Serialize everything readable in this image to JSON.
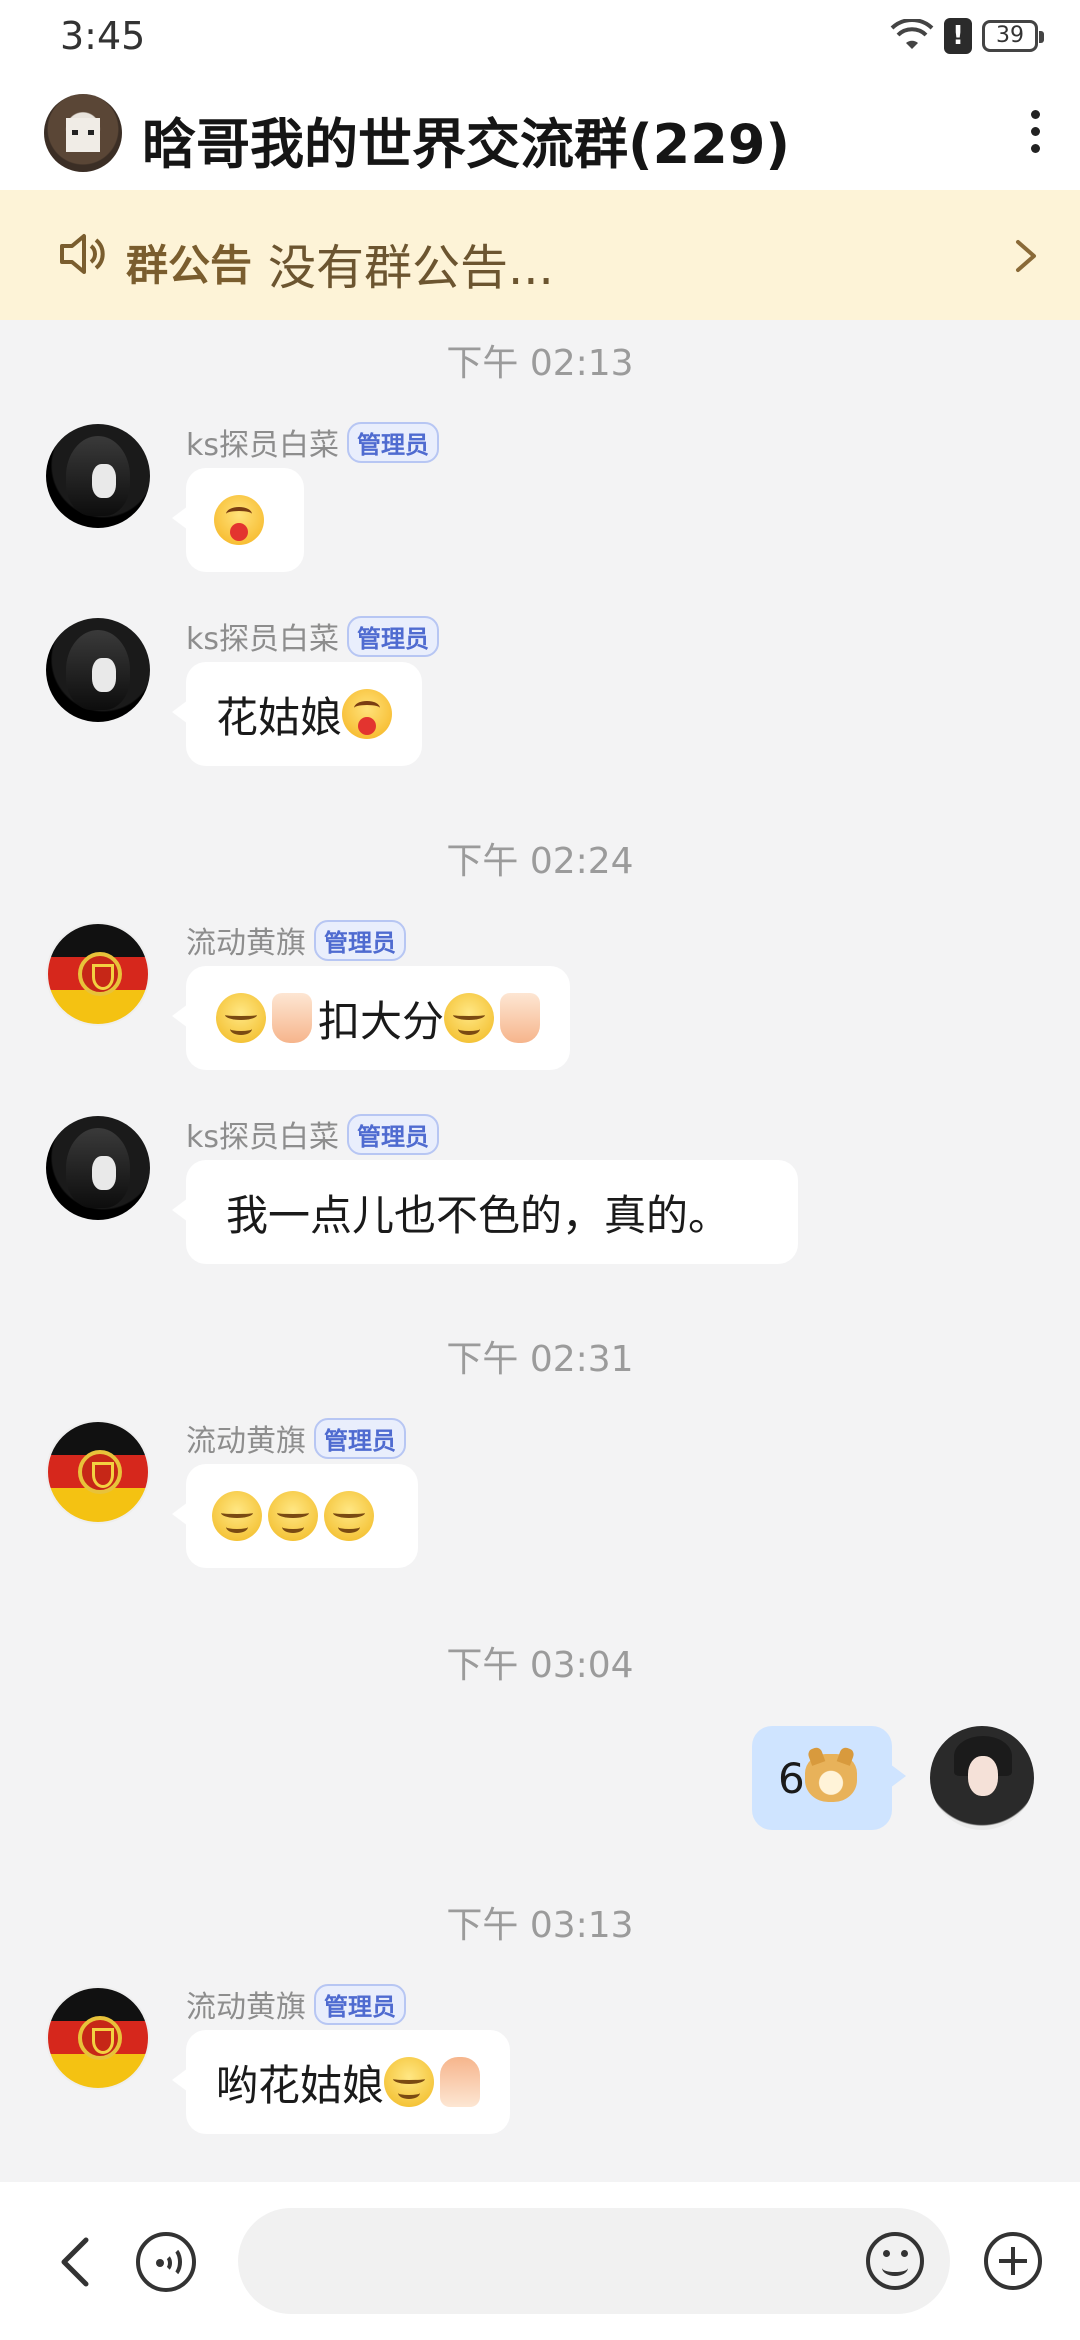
{
  "status_bar": {
    "time": "3:45",
    "battery": "39"
  },
  "header": {
    "title": "晗哥我的世界交流群(229)"
  },
  "announcement": {
    "label": "群公告",
    "text": "没有群公告..."
  },
  "timestamps": [
    "下午 02:13",
    "下午 02:24",
    "下午 02:31",
    "下午 03:04",
    "下午 03:13"
  ],
  "admin_label": "管理员",
  "messages": [
    {
      "sender": "ks探员白菜",
      "text": ""
    },
    {
      "sender": "ks探员白菜",
      "text": "花姑娘"
    },
    {
      "sender": "流动黄旗",
      "text": "扣大分"
    },
    {
      "sender": "ks探员白菜",
      "text": "我一点儿也不色的，真的。"
    },
    {
      "sender": "流动黄旗",
      "text": ""
    },
    {
      "sender": "me",
      "text": "6"
    },
    {
      "sender": "流动黄旗",
      "text": "哟花姑娘"
    }
  ],
  "input": {
    "placeholder": ""
  },
  "icons": {
    "emoji_tongue": "tongue-out-emoji-icon",
    "emoji_smug": "smug-face-emoji-icon",
    "thumbs_down": "thumbs-down-emoji-icon",
    "thumbs_up": "thumbs-up-emoji-icon",
    "doge": "doge-emoji-icon"
  },
  "colors": {
    "bubble_mine": "#cfe4ff",
    "announcement_bg": "#fdf3d7",
    "admin_badge": "#4f6bd0"
  }
}
